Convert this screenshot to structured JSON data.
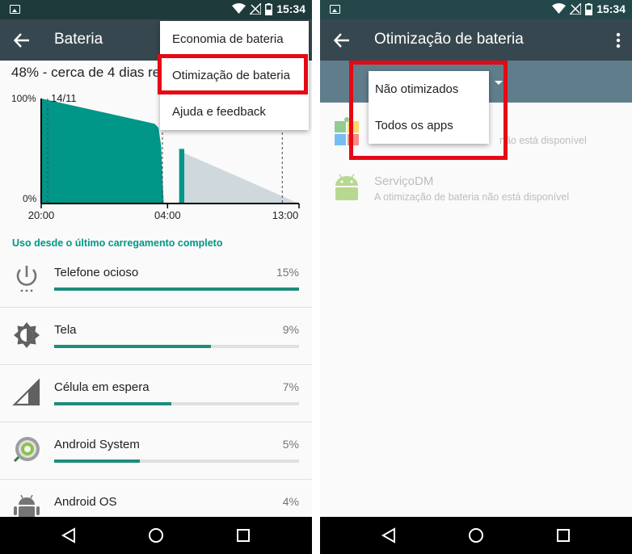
{
  "left": {
    "status": {
      "time": "15:34"
    },
    "appbar": {
      "title": "Bateria"
    },
    "summary": "48% - cerca de 4 dias res",
    "chart_data": {
      "type": "area",
      "y_tick_labels": [
        "100%",
        "0%"
      ],
      "x_tick_labels": [
        "20:00",
        "04:00",
        "13:00"
      ],
      "annotation": "14/11",
      "series": [
        {
          "color": "#009688",
          "segments": [
            {
              "x": [
                0.0,
                0.44,
                0.455,
                0.465,
                0.475
              ],
              "y": [
                100,
                76,
                72,
                55,
                0
              ]
            },
            {
              "x": [
                0.535,
                0.555
              ],
              "y": [
                52,
                52
              ]
            }
          ]
        },
        {
          "color": "#cfd8dc",
          "points": {
            "x": [
              0.555,
              1.0
            ],
            "y": [
              48,
              0
            ]
          }
        }
      ]
    },
    "section_title": "Uso desde o último carregamento completo",
    "usage": [
      {
        "icon": "power-icon",
        "name": "Telefone ocioso",
        "pct": "15%",
        "fraction": 1.0
      },
      {
        "icon": "brightness-icon",
        "name": "Tela",
        "pct": "9%",
        "fraction": 0.64
      },
      {
        "icon": "cell-signal-icon",
        "name": "Célula em espera",
        "pct": "7%",
        "fraction": 0.48
      },
      {
        "icon": "android-system-icon",
        "name": "Android System",
        "pct": "5%",
        "fraction": 0.35
      },
      {
        "icon": "android-os-icon",
        "name": "Android OS",
        "pct": "4%",
        "fraction": 0.3
      }
    ],
    "menu": {
      "items": [
        "Economia de bateria",
        "Otimização de bateria",
        "Ajuda e feedback"
      ],
      "highlighted_index": 1
    },
    "highlight_color": "#e50914"
  },
  "right": {
    "status": {
      "time": "15:34"
    },
    "appbar": {
      "title": "Otimização de bateria"
    },
    "dropdown": {
      "options": [
        "Não otimizados",
        "Todos os apps"
      ]
    },
    "apps": [
      {
        "icon": "puzzle-app-icon",
        "name": "",
        "sub": "não está disponível"
      },
      {
        "icon": "android-app-icon",
        "name": "ServiçoDM",
        "sub": "A otimização de bateria não está disponível"
      }
    ]
  }
}
